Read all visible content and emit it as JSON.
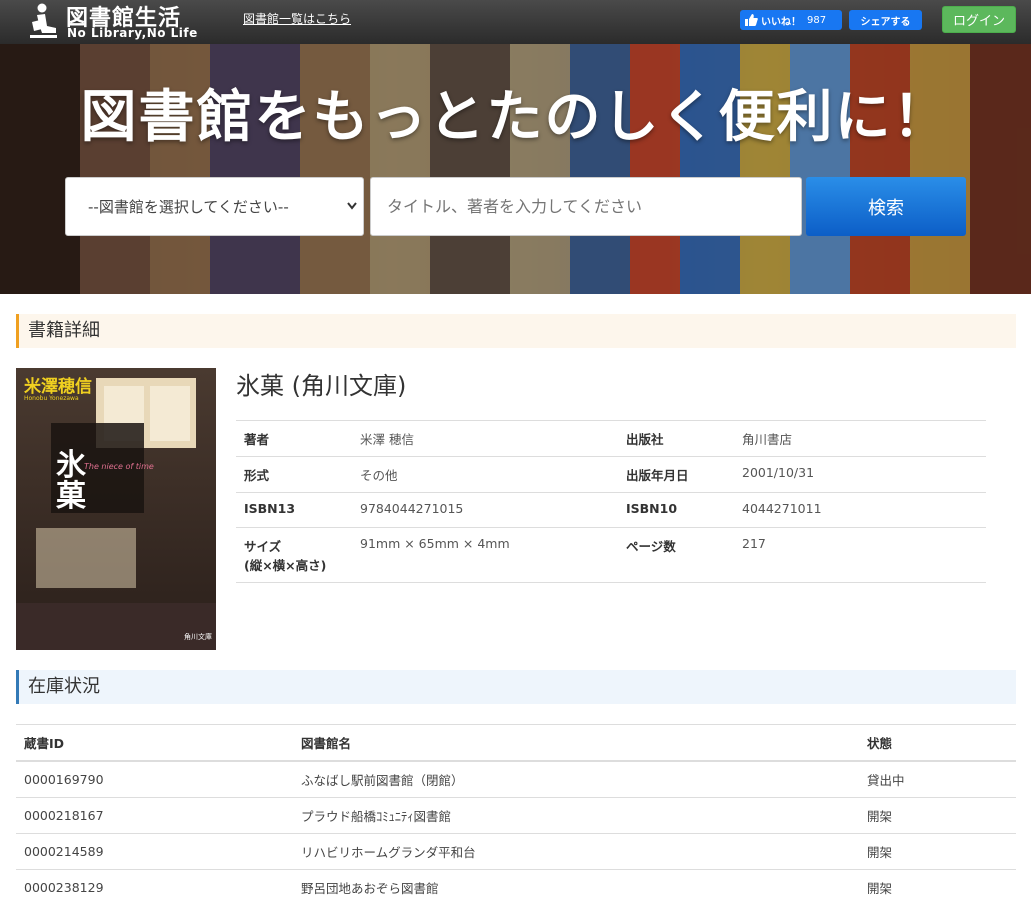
{
  "header": {
    "logo_jp": "図書館生活",
    "logo_en": "No Library,No Life",
    "libraries_link": "図書館一覧はこちら",
    "fb_like_label": "いいね！",
    "fb_like_count": "987",
    "fb_share_label": "シェアする",
    "login_label": "ログイン"
  },
  "hero": {
    "title": "図書館をもっとたのしく便利に！",
    "select_value": "--図書館を選択してください--",
    "search_placeholder": "タイトル、著者を入力してください",
    "search_button": "検索"
  },
  "detail_section": {
    "heading": "書籍詳細",
    "book_title": "氷菓 (角川文庫)",
    "cover": {
      "author_text": "米澤穂信",
      "author_romaji": "Honobu Yonezawa",
      "title_text": "氷菓",
      "subtitle": "The niece of time",
      "publisher_mark": "角川文庫"
    },
    "rows": [
      {
        "k1": "著者",
        "v1": "米澤 穂信",
        "k2": "出版社",
        "v2": "角川書店"
      },
      {
        "k1": "形式",
        "v1": "その他",
        "k2": "出版年月日",
        "v2": "2001/10/31"
      },
      {
        "k1": "ISBN13",
        "v1": "9784044271015",
        "k2": "ISBN10",
        "v2": "4044271011"
      },
      {
        "k1": "サイズ",
        "k1b": "(縦×横×高さ)",
        "v1": "91mm × 65mm × 4mm",
        "k2": "ページ数",
        "v2": "217"
      }
    ]
  },
  "stock_section": {
    "heading": "在庫状況",
    "columns": [
      "蔵書ID",
      "図書館名",
      "状態"
    ],
    "rows": [
      {
        "id": "0000169790",
        "library": "ふなばし駅前図書館（閉館）",
        "status": "貸出中"
      },
      {
        "id": "0000218167",
        "library": "プラウド船橋ｺﾐｭﾆﾃｨ図書館",
        "status": "開架"
      },
      {
        "id": "0000214589",
        "library": "リハビリホームグランダ平和台",
        "status": "開架"
      },
      {
        "id": "0000238129",
        "library": "野呂団地あおぞら図書館",
        "status": "開架"
      }
    ]
  }
}
